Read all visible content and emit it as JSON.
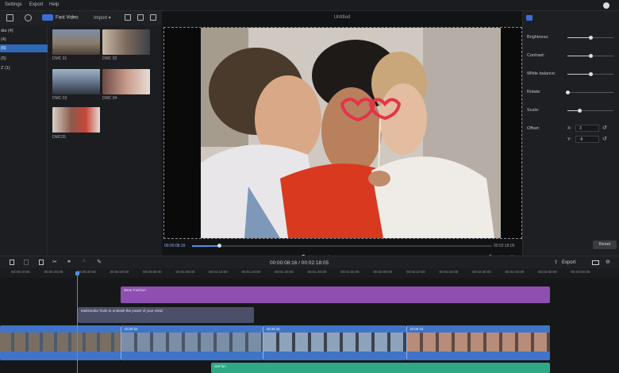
{
  "menu": {
    "settings": "Settings",
    "export": "Export",
    "help": "Help"
  },
  "toolbar": {
    "fast_video": "Fast Video",
    "import": "Import"
  },
  "categories": [
    "dia (4)",
    "(4)",
    "(6)",
    "(5)",
    "Z (1)"
  ],
  "media": [
    {
      "label": "DMC 01"
    },
    {
      "label": "DMC 02"
    },
    {
      "label": "DMC 03"
    },
    {
      "label": "DMC 04"
    },
    {
      "label": "DMC05"
    }
  ],
  "preview": {
    "title": "Untitled",
    "current_time": "00:00:08:16",
    "total_time": "00:02:18:05",
    "progress": 0.09
  },
  "properties": {
    "brightness": {
      "label": "Brightness:",
      "value": 0.5
    },
    "contrast": {
      "label": "Contrast:",
      "value": 0.5
    },
    "white_balance": {
      "label": "White balance:",
      "value": 0.5
    },
    "rotate": {
      "label": "Rotate:",
      "value": 0.0
    },
    "scale": {
      "label": "Scale:",
      "value": 0.25
    },
    "offset_label": "Offset:",
    "offset_x_label": "X:",
    "offset_x": "3",
    "offset_y_label": "Y:",
    "offset_y": "-5",
    "reset": "Reset"
  },
  "timeline": {
    "time": "00:00:08:16 / 00:02:18:05",
    "export": "Export",
    "ticks": [
      "00:00:10:00",
      "00:00:20:00",
      "00:00:30:00",
      "00:00:40:00",
      "00:00:50:00",
      "00:01:00:00",
      "00:01:10:00",
      "00:01:20:00",
      "00:01:30:00",
      "00:01:40:00",
      "00:01:50:00",
      "00:02:00:00",
      "00:02:10:00",
      "00:02:20:00",
      "00:02:30:00",
      "00:02:40:00",
      "00:02:50:00",
      "00:03:00:00"
    ],
    "clip_purple": "Wear Fashion",
    "clip_text": "Multimedia Tools to unleash the power of your mind.",
    "clip_green": "Get fun",
    "video_clips": [
      "DCM 02",
      "DCM 03",
      "DCM 04"
    ]
  },
  "colors": {
    "accent": "#4d8ef0",
    "clip_purple": "#8e4fb0",
    "clip_text": "#4b5068",
    "clip_video": "#3f74c8",
    "clip_green": "#2fa886"
  }
}
